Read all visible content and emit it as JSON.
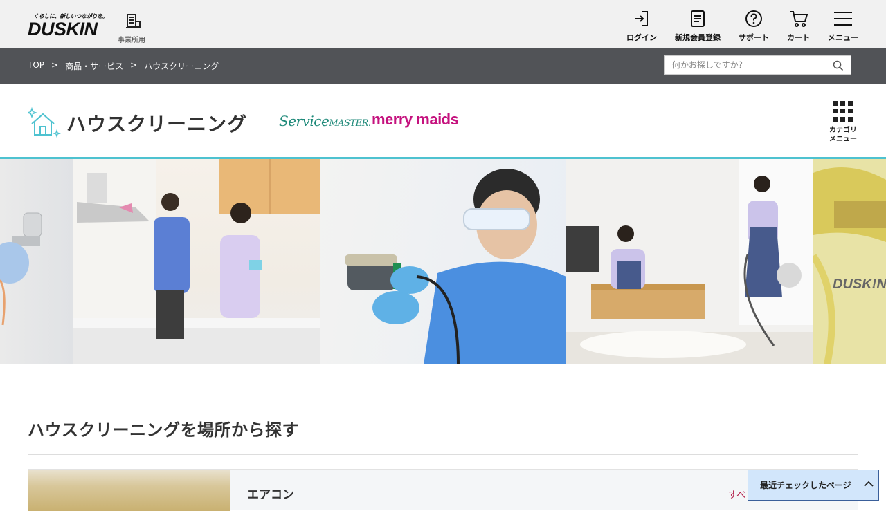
{
  "header": {
    "logo_tagline": "くらしに、新しいつながりを。",
    "logo_text": "DUSKIN",
    "business_label": "事業所用",
    "nav": [
      {
        "label": "ログイン",
        "icon": "login-icon"
      },
      {
        "label": "新規会員登録",
        "icon": "register-icon"
      },
      {
        "label": "サポート",
        "icon": "support-icon"
      },
      {
        "label": "カート",
        "icon": "cart-icon"
      },
      {
        "label": "メニュー",
        "icon": "hamburger-icon"
      }
    ]
  },
  "breadcrumb": {
    "items": [
      "TOP",
      "商品・サービス",
      "ハウスクリーニング"
    ],
    "separator": ">"
  },
  "search": {
    "placeholder": "何かお探しですか？"
  },
  "page": {
    "title": "ハウスクリーニング",
    "brand1_main": "Service",
    "brand1_sub": "MASTER.",
    "brand2": "merry maids",
    "category_menu": "カテゴリ\nメニュー"
  },
  "section": {
    "title": "ハウスクリーニングを場所から探す",
    "card_title": "エアコン",
    "card_link": "すべ"
  },
  "recent": {
    "label": "最近チェックしたページ"
  },
  "hero": {
    "watermark": "DUSK!N"
  },
  "colors": {
    "accent": "#4ec2d0",
    "breadcrumb_bg": "#515357",
    "brand_servicemaster": "#1f8a7a",
    "brand_merrymaids": "#c5127e",
    "link": "#b4234e",
    "recent_bg": "#d2e6fb"
  }
}
